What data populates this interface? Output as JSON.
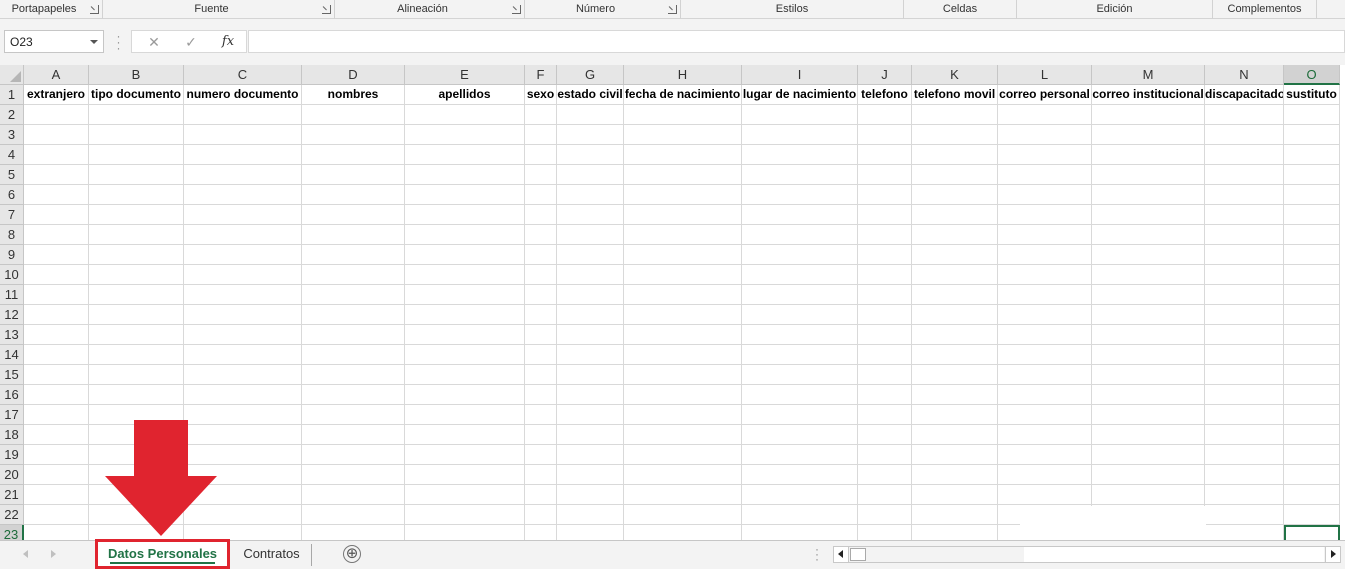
{
  "ribbon": {
    "groups": [
      {
        "label": "Portapapeles",
        "launcher": true
      },
      {
        "label": "Fuente",
        "launcher": true
      },
      {
        "label": "Alineación",
        "launcher": true
      },
      {
        "label": "Número",
        "launcher": true
      },
      {
        "label": "Estilos",
        "launcher": false
      },
      {
        "label": "Celdas",
        "launcher": false
      },
      {
        "label": "Edición",
        "launcher": false
      },
      {
        "label": "Complementos",
        "launcher": false
      }
    ]
  },
  "formula_bar": {
    "name_box": "O23",
    "cancel_icon": "✕",
    "enter_icon": "✓",
    "function_icon": "fx",
    "formula_value": ""
  },
  "grid": {
    "columns": [
      "A",
      "B",
      "C",
      "D",
      "E",
      "F",
      "G",
      "H",
      "I",
      "J",
      "K",
      "L",
      "M",
      "N",
      "O"
    ],
    "selected_column": "O",
    "row_numbers": [
      "1",
      "2",
      "3",
      "4",
      "5",
      "6",
      "7",
      "8",
      "9",
      "10",
      "11",
      "12",
      "13",
      "14",
      "15",
      "16",
      "17",
      "18",
      "19",
      "20",
      "21",
      "22",
      "23"
    ],
    "selected_row": "23",
    "header_row": [
      "extranjero",
      "tipo documento",
      "numero documento",
      "nombres",
      "apellidos",
      "sexo",
      "estado civil",
      "fecha de nacimiento",
      "lugar de nacimiento",
      "telefono",
      "telefono movil",
      "correo personal",
      "correo institucional",
      "discapacitado",
      "sustituto"
    ]
  },
  "sheet_tabs": {
    "tabs": [
      "Datos Personales",
      "Contratos"
    ],
    "active": "Datos Personales",
    "add_icon": "⊕"
  },
  "colors": {
    "accent": "#217346",
    "highlight_red": "#e0242f"
  }
}
